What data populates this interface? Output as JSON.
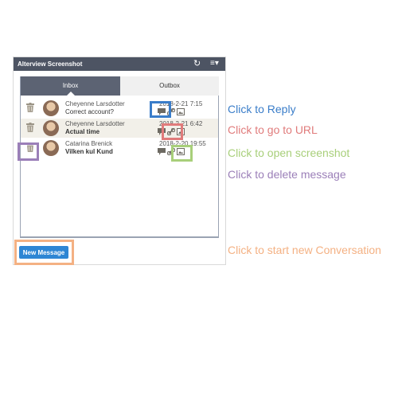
{
  "widget": {
    "title": "Alterview Screenshot",
    "refresh_icon": "↻",
    "menu_icon": "≡▾"
  },
  "tabs": [
    {
      "label": "Inbox",
      "active": true
    },
    {
      "label": "Outbox",
      "active": false
    }
  ],
  "messages": [
    {
      "sender": "Cheyenne Larsdotter",
      "subject": "Correct account?",
      "subject_bold": false,
      "date": "2018-2-21 7:15",
      "actions": [
        "reply-icon",
        "link-icon",
        "screenshot-icon"
      ]
    },
    {
      "sender": "Cheyenne Larsdotter",
      "subject": "Actual time",
      "subject_bold": true,
      "date": "2018-2-21 6:42",
      "actions": [
        "reply-icon",
        "link-icon",
        "screenshot-icon"
      ]
    },
    {
      "sender": "Catarina Brenick",
      "subject": "Vilken kul Kund",
      "subject_bold": true,
      "date": "2018-2-20 19:55",
      "actions": [
        "reply-icon",
        "link-icon",
        "screenshot-icon"
      ]
    }
  ],
  "new_message_label": "New Message",
  "annotations": [
    {
      "text": "Click to Reply",
      "color": "#3a7dc9"
    },
    {
      "text": "Click to go to URL",
      "color": "#e07b7b"
    },
    {
      "text": "Click to open screenshot",
      "color": "#a8cf7a"
    },
    {
      "text": "Click to delete message",
      "color": "#9b7fb8"
    },
    {
      "text": "Click to start new Conversation",
      "color": "#f4b183"
    }
  ]
}
